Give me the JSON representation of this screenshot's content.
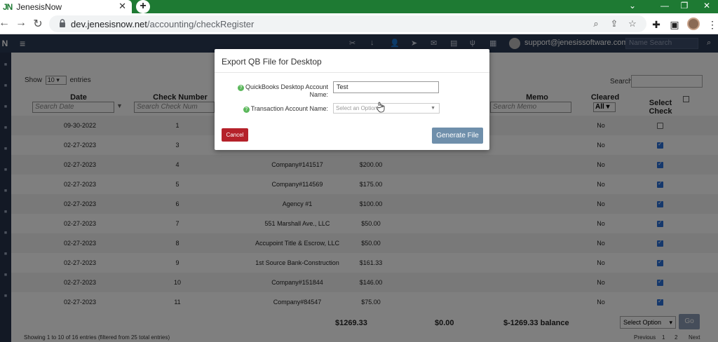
{
  "browser": {
    "tab_title": "JenesisNow",
    "tab_logo": "JN",
    "url_host": "dev.jenesisnow.net",
    "url_path": "/accounting/checkRegister"
  },
  "appnav": {
    "brand": "N",
    "user_email": "support@jenesissoftware.com",
    "search_placeholder": "Name Search"
  },
  "table_controls": {
    "show_label": "Show",
    "entries_count": "10",
    "entries_label": "entries",
    "search_label": "Search"
  },
  "columns": {
    "date": "Date",
    "check_number": "Check Number",
    "memo": "Memo",
    "cleared": "Cleared",
    "select_check": "Select Check",
    "filter_date": "Search Date",
    "filter_check": "Search Check Num",
    "filter_memo": "Search Memo",
    "cleared_filter": "All"
  },
  "rows": [
    {
      "date": "09-30-2022",
      "check": "1",
      "payee": "",
      "amount": "",
      "cleared": "No",
      "selected": false
    },
    {
      "date": "02-27-2023",
      "check": "3",
      "payee": "",
      "amount": "",
      "cleared": "No",
      "selected": true
    },
    {
      "date": "02-27-2023",
      "check": "4",
      "payee": "Company#141517",
      "amount": "$200.00",
      "cleared": "No",
      "selected": true
    },
    {
      "date": "02-27-2023",
      "check": "5",
      "payee": "Company#114569",
      "amount": "$175.00",
      "cleared": "No",
      "selected": true
    },
    {
      "date": "02-27-2023",
      "check": "6",
      "payee": "Agency #1",
      "amount": "$100.00",
      "cleared": "No",
      "selected": true
    },
    {
      "date": "02-27-2023",
      "check": "7",
      "payee": "551 Marshall Ave., LLC",
      "amount": "$50.00",
      "cleared": "No",
      "selected": true
    },
    {
      "date": "02-27-2023",
      "check": "8",
      "payee": "Accupoint Title & Escrow, LLC",
      "amount": "$50.00",
      "cleared": "No",
      "selected": true
    },
    {
      "date": "02-27-2023",
      "check": "9",
      "payee": "1st Source Bank-Construction",
      "amount": "$161.33",
      "cleared": "No",
      "selected": true
    },
    {
      "date": "02-27-2023",
      "check": "10",
      "payee": "Company#151844",
      "amount": "$146.00",
      "cleared": "No",
      "selected": true
    },
    {
      "date": "02-27-2023",
      "check": "11",
      "payee": "Company#84547",
      "amount": "$75.00",
      "cleared": "No",
      "selected": true
    }
  ],
  "totals": {
    "debits": "$1269.33",
    "credits": "$0.00",
    "balance": "$-1269.33 balance"
  },
  "bottom": {
    "select_option": "Select Option",
    "go_label": "Go",
    "info": "Showing 1 to 10 of 16 entries (filtered from 25 total entries)",
    "prev": "Previous",
    "page1": "1",
    "page2": "2",
    "next": "Next"
  },
  "modal": {
    "title": "Export QB File for Desktop",
    "qb_account_label": "QuickBooks Desktop Account Name:",
    "qb_account_value": "Test",
    "txn_account_label": "Transaction Account Name:",
    "txn_account_placeholder": "Select an Option",
    "cancel_label": "Cancel",
    "generate_label": "Generate File"
  },
  "colors": {
    "tabstrip": "#1e7a33",
    "appnav": "#2b3a55",
    "cancel": "#b5212a",
    "generate": "#6f8fab",
    "checkbox": "#2a70d9"
  }
}
